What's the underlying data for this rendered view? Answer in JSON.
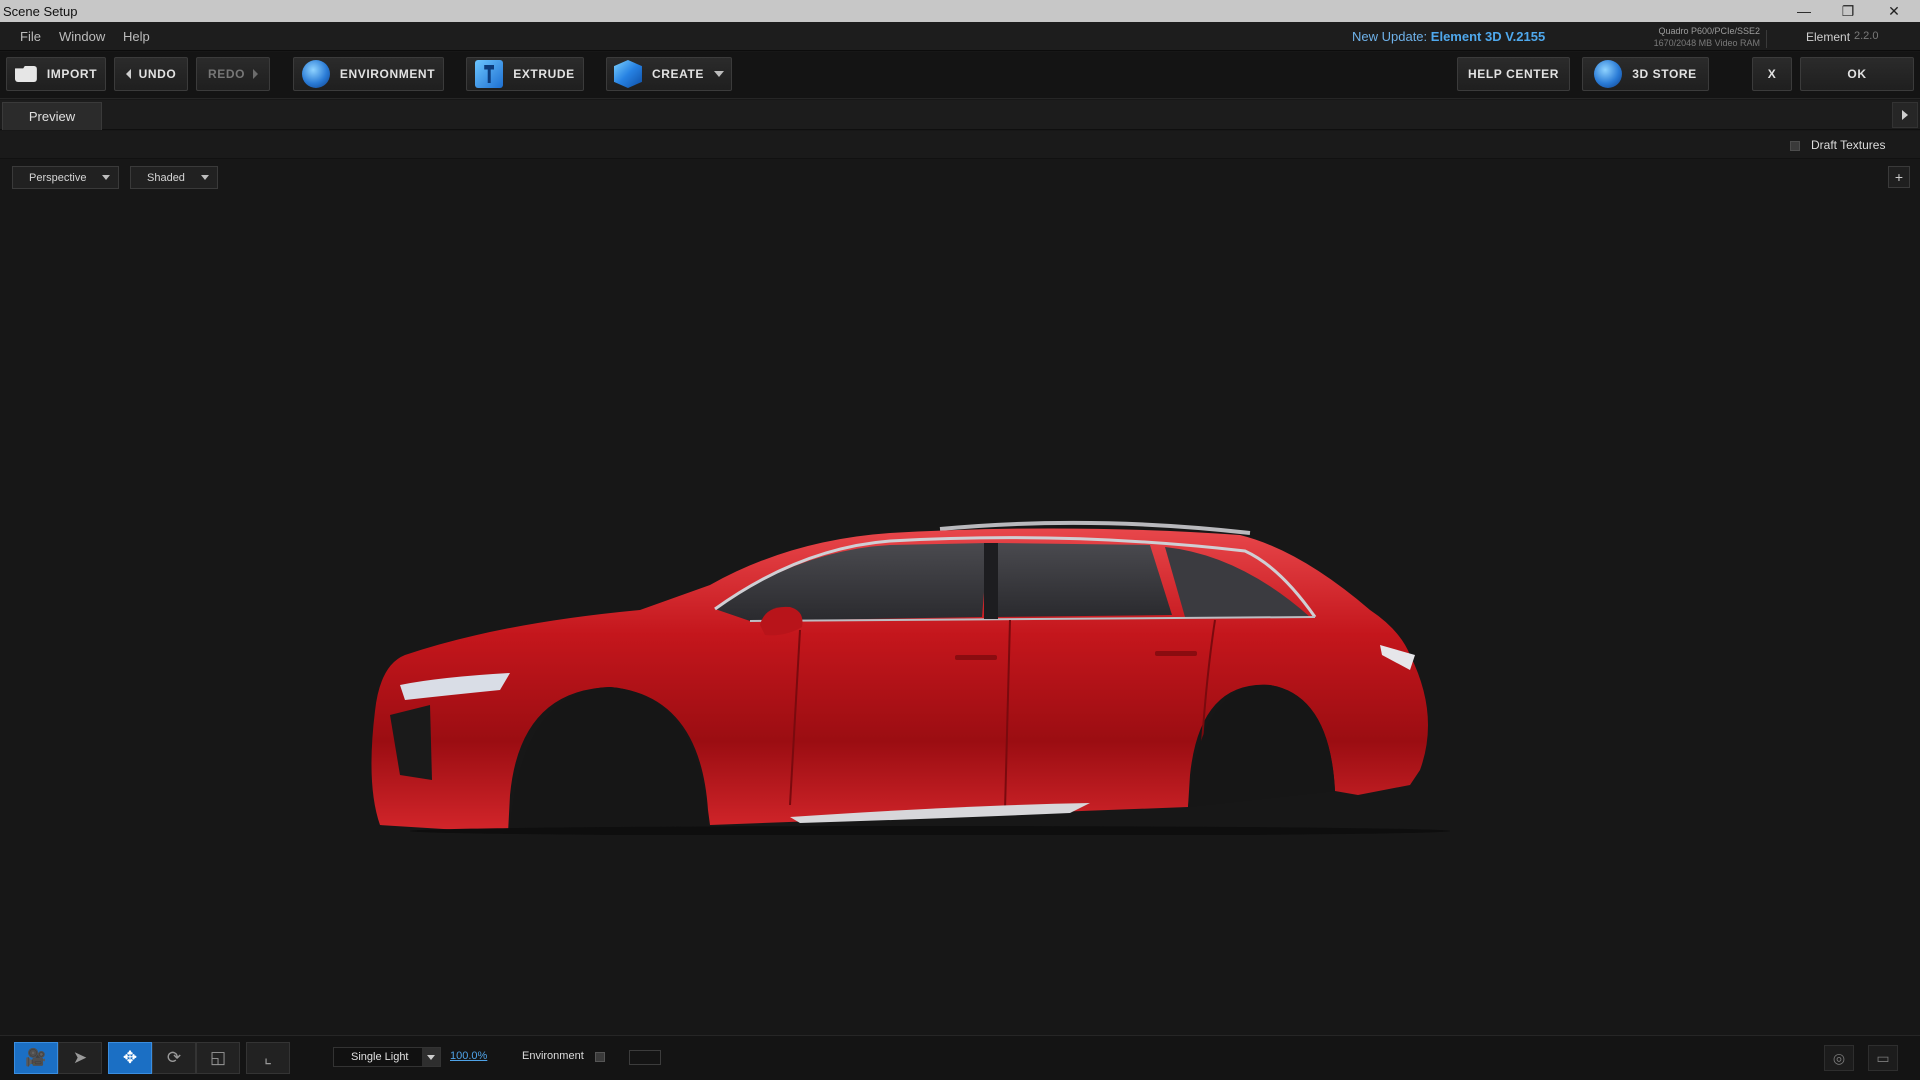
{
  "window": {
    "title": "Scene Setup",
    "controls": {
      "minimize": "—",
      "restore": "❐",
      "close": "✕"
    }
  },
  "menu": {
    "file": "File",
    "window": "Window",
    "help": "Help"
  },
  "update": {
    "prefix": "New Update:",
    "version": "Element 3D V.2155"
  },
  "gpu": {
    "line1": "Quadro P600/PCIe/SSE2",
    "line2": "1670/2048 MB Video RAM"
  },
  "product": {
    "name": "Element",
    "version": "2.2.0"
  },
  "toolbar": {
    "import": "IMPORT",
    "undo": "UNDO",
    "redo": "REDO",
    "environment": "ENVIRONMENT",
    "extrude": "EXTRUDE",
    "create": "CREATE",
    "help_center": "HELP CENTER",
    "store": "3D STORE",
    "close": "X",
    "ok": "OK"
  },
  "tabs": {
    "preview": "Preview"
  },
  "options": {
    "draft_textures": "Draft Textures"
  },
  "viewport": {
    "camera_mode": "Perspective",
    "shading_mode": "Shaded",
    "maximize_glyph": "+",
    "model_color": "#c4161c"
  },
  "bottom": {
    "light_mode": "Single Light",
    "light_intensity": "100.0%",
    "environment_label": "Environment",
    "tool_icons": {
      "camera": "🎥",
      "select": "➤",
      "move": "✥",
      "rotate": "⟳",
      "scale": "◱",
      "axis": "⌞"
    },
    "view_icons": {
      "light_target": "◎",
      "display": "▭"
    }
  },
  "colors": {
    "accent": "#1b6fc4",
    "link": "#4fa3e8",
    "background": "#171717"
  }
}
